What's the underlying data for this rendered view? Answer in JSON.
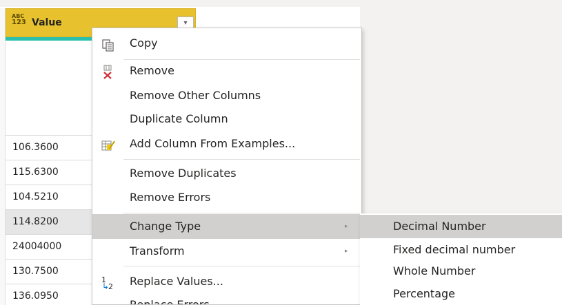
{
  "column": {
    "type_icon_top": "ABC",
    "type_icon_bottom": "123",
    "title": "Value",
    "dropdown_glyph": "▾"
  },
  "rows": [
    "106.3600",
    "115.6300",
    "104.5210",
    "114.8200",
    "24004000",
    "130.7500",
    "136.0950"
  ],
  "selected_row": 3,
  "context_menu": {
    "items": [
      {
        "label": "Copy",
        "icon": "copy-icon"
      },
      {
        "label": "Remove",
        "icon": "remove-column-icon"
      },
      {
        "label": "Remove Other Columns"
      },
      {
        "label": "Duplicate Column"
      },
      {
        "label": "Add Column From Examples...",
        "icon": "column-from-examples-icon"
      },
      {
        "label": "Remove Duplicates"
      },
      {
        "label": "Remove Errors"
      },
      {
        "label": "Change Type",
        "submenu": true,
        "highlighted": true
      },
      {
        "label": "Transform",
        "submenu": true
      },
      {
        "label": "Replace Values...",
        "icon": "replace-values-icon",
        "icon_text_top": "1",
        "icon_text_bottom": "2"
      },
      {
        "label": "Replace Errors..."
      }
    ],
    "arrow_glyph": "▸"
  },
  "change_type_submenu": {
    "items": [
      {
        "label": "Decimal Number",
        "highlighted": true
      },
      {
        "label": "Fixed decimal number"
      },
      {
        "label": "Whole Number"
      },
      {
        "label": "Percentage"
      }
    ]
  },
  "colors": {
    "header_bg": "#e8c22e",
    "quality_bar": "#2bbfae",
    "highlight": "#d2d0ce",
    "remove_icon": "#d13438"
  }
}
